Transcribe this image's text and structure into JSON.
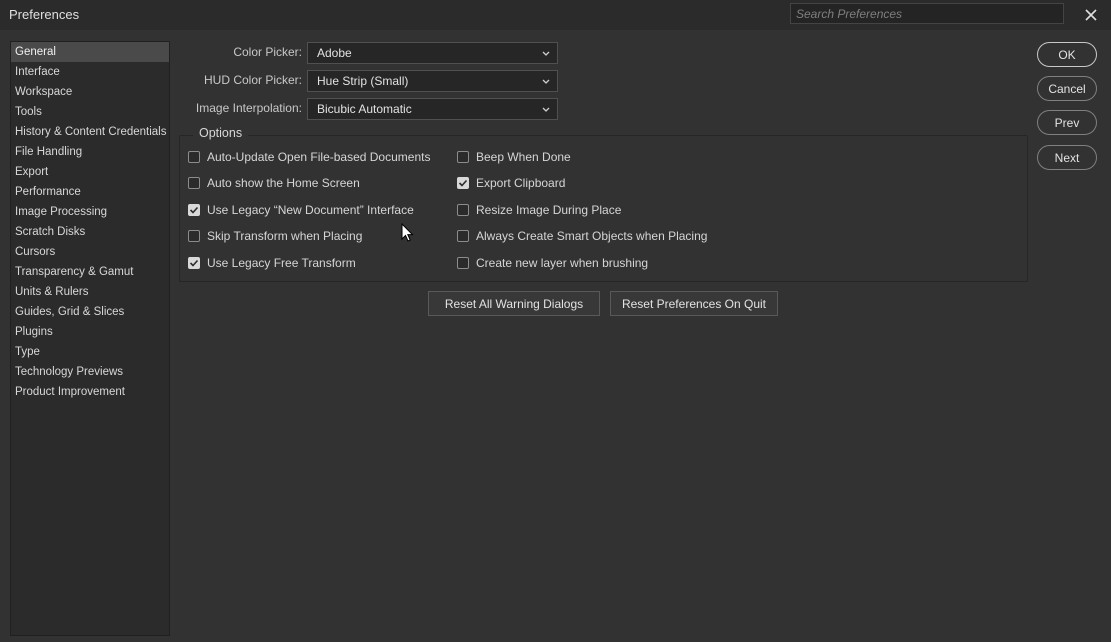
{
  "window": {
    "title": "Preferences"
  },
  "search": {
    "placeholder": "Search Preferences"
  },
  "sidebar": {
    "items": [
      {
        "label": "General",
        "active": true
      },
      {
        "label": "Interface"
      },
      {
        "label": "Workspace"
      },
      {
        "label": "Tools"
      },
      {
        "label": "History & Content Credentials"
      },
      {
        "label": "File Handling"
      },
      {
        "label": "Export"
      },
      {
        "label": "Performance"
      },
      {
        "label": "Image Processing"
      },
      {
        "label": "Scratch Disks"
      },
      {
        "label": "Cursors"
      },
      {
        "label": "Transparency & Gamut"
      },
      {
        "label": "Units & Rulers"
      },
      {
        "label": "Guides, Grid & Slices"
      },
      {
        "label": "Plugins"
      },
      {
        "label": "Type"
      },
      {
        "label": "Technology Previews"
      },
      {
        "label": "Product Improvement"
      }
    ]
  },
  "fields": {
    "color_picker": {
      "label": "Color Picker:",
      "value": "Adobe"
    },
    "hud_color_picker": {
      "label": "HUD Color Picker:",
      "value": "Hue Strip (Small)"
    },
    "image_interpolation": {
      "label": "Image Interpolation:",
      "value": "Bicubic Automatic"
    }
  },
  "options": {
    "title": "Options",
    "left": [
      {
        "label": "Auto-Update Open File-based Documents",
        "checked": false
      },
      {
        "label": "Auto show the Home Screen",
        "checked": false
      },
      {
        "label": "Use Legacy “New Document” Interface",
        "checked": true
      },
      {
        "label": "Skip Transform when Placing",
        "checked": false
      },
      {
        "label": "Use Legacy Free Transform",
        "checked": true
      }
    ],
    "right": [
      {
        "label": "Beep When Done",
        "checked": false
      },
      {
        "label": "Export Clipboard",
        "checked": true
      },
      {
        "label": "Resize Image During Place",
        "checked": false
      },
      {
        "label": "Always Create Smart Objects when Placing",
        "checked": false
      },
      {
        "label": "Create new layer when brushing",
        "checked": false
      }
    ]
  },
  "buttons": {
    "reset_warnings": "Reset All Warning Dialogs",
    "reset_prefs": "Reset Preferences On Quit",
    "ok": "OK",
    "cancel": "Cancel",
    "prev": "Prev",
    "next": "Next"
  },
  "icons": {
    "close": "close-icon",
    "dropdown": "chevron-down-icon",
    "check": "checkmark-icon",
    "cursor": "mouse-pointer-icon"
  }
}
